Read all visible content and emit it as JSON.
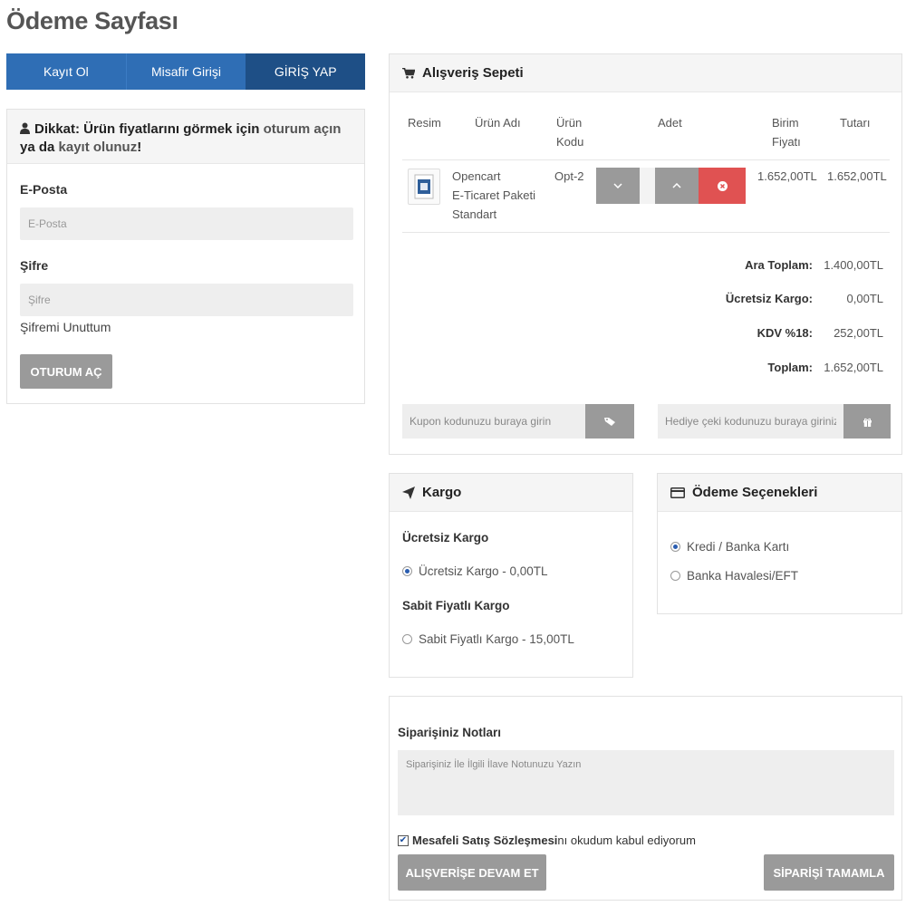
{
  "page": {
    "title": "Ödeme Sayfası"
  },
  "tabs": [
    {
      "label": "Kayıt Ol"
    },
    {
      "label": "Misafir Girişi"
    },
    {
      "label": "GİRİŞ YAP"
    }
  ],
  "login": {
    "warning_prefix": "Dikkat: Ürün fiyatlarını görmek için ",
    "warning_link1": "oturum açın",
    "warning_mid": " ya da ",
    "warning_link2": "kayıt olunuz",
    "warning_suffix": "!",
    "email_label": "E-Posta",
    "email_placeholder": "E-Posta",
    "password_label": "Şifre",
    "password_placeholder": "Şifre",
    "forgot": "Şifremi Unuttum",
    "submit": "OTURUM AÇ"
  },
  "cart": {
    "title": "Alışveriş Sepeti",
    "headers": {
      "image": "Resim",
      "name": "Ürün Adı",
      "code_line1": "Ürün",
      "code_line2": "Kodu",
      "qty": "Adet",
      "unit_line1": "Birim",
      "unit_line2": "Fiyatı",
      "total": "Tutarı"
    },
    "item": {
      "name_line1": "Opencart",
      "name_line2": "E-Ticaret Paketi",
      "name_line3": "Standart",
      "code": "Opt-2",
      "unit_price": "1.652,00TL",
      "total": "1.652,00TL"
    },
    "totals": [
      {
        "label": "Ara Toplam:",
        "value": "1.400,00TL"
      },
      {
        "label": "Ücretsiz Kargo:",
        "value": "0,00TL"
      },
      {
        "label": "KDV %18:",
        "value": "252,00TL"
      },
      {
        "label": "Toplam:",
        "value": "1.652,00TL"
      }
    ],
    "coupon_placeholder": "Kupon kodunuzu buraya girin",
    "gift_placeholder": "Hediye çeki kodunuzu buraya giriniz"
  },
  "shipping": {
    "title": "Kargo",
    "group1": "Ücretsiz Kargo",
    "option1": "Ücretsiz Kargo - 0,00TL",
    "option1_selected": true,
    "group2": "Sabit Fiyatlı Kargo",
    "option2": "Sabit Fiyatlı Kargo - 15,00TL",
    "option2_selected": false
  },
  "payment": {
    "title": "Ödeme Seçenekleri",
    "option1": "Kredi / Banka Kartı",
    "option1_selected": true,
    "option2": "Banka Havalesi/EFT",
    "option2_selected": false
  },
  "notes": {
    "label": "Siparişiniz Notları",
    "placeholder": "Siparişiniz İle İlgili İlave Notunuzu Yazın",
    "agree_bold": "Mesafeli Satış Sözleşmesi",
    "agree_rest": " nı okudum kabul ediyorum",
    "agree_checked": true,
    "continue_button": "ALIŞVERİŞE DEVAM ET",
    "complete_button": "SİPARİŞİ TAMAMLA"
  },
  "colors": {
    "tab_blue": "#2f6eb5",
    "tab_active": "#1e4f86",
    "button_gray": "#9a9a9a",
    "delete_red": "#e05252"
  }
}
